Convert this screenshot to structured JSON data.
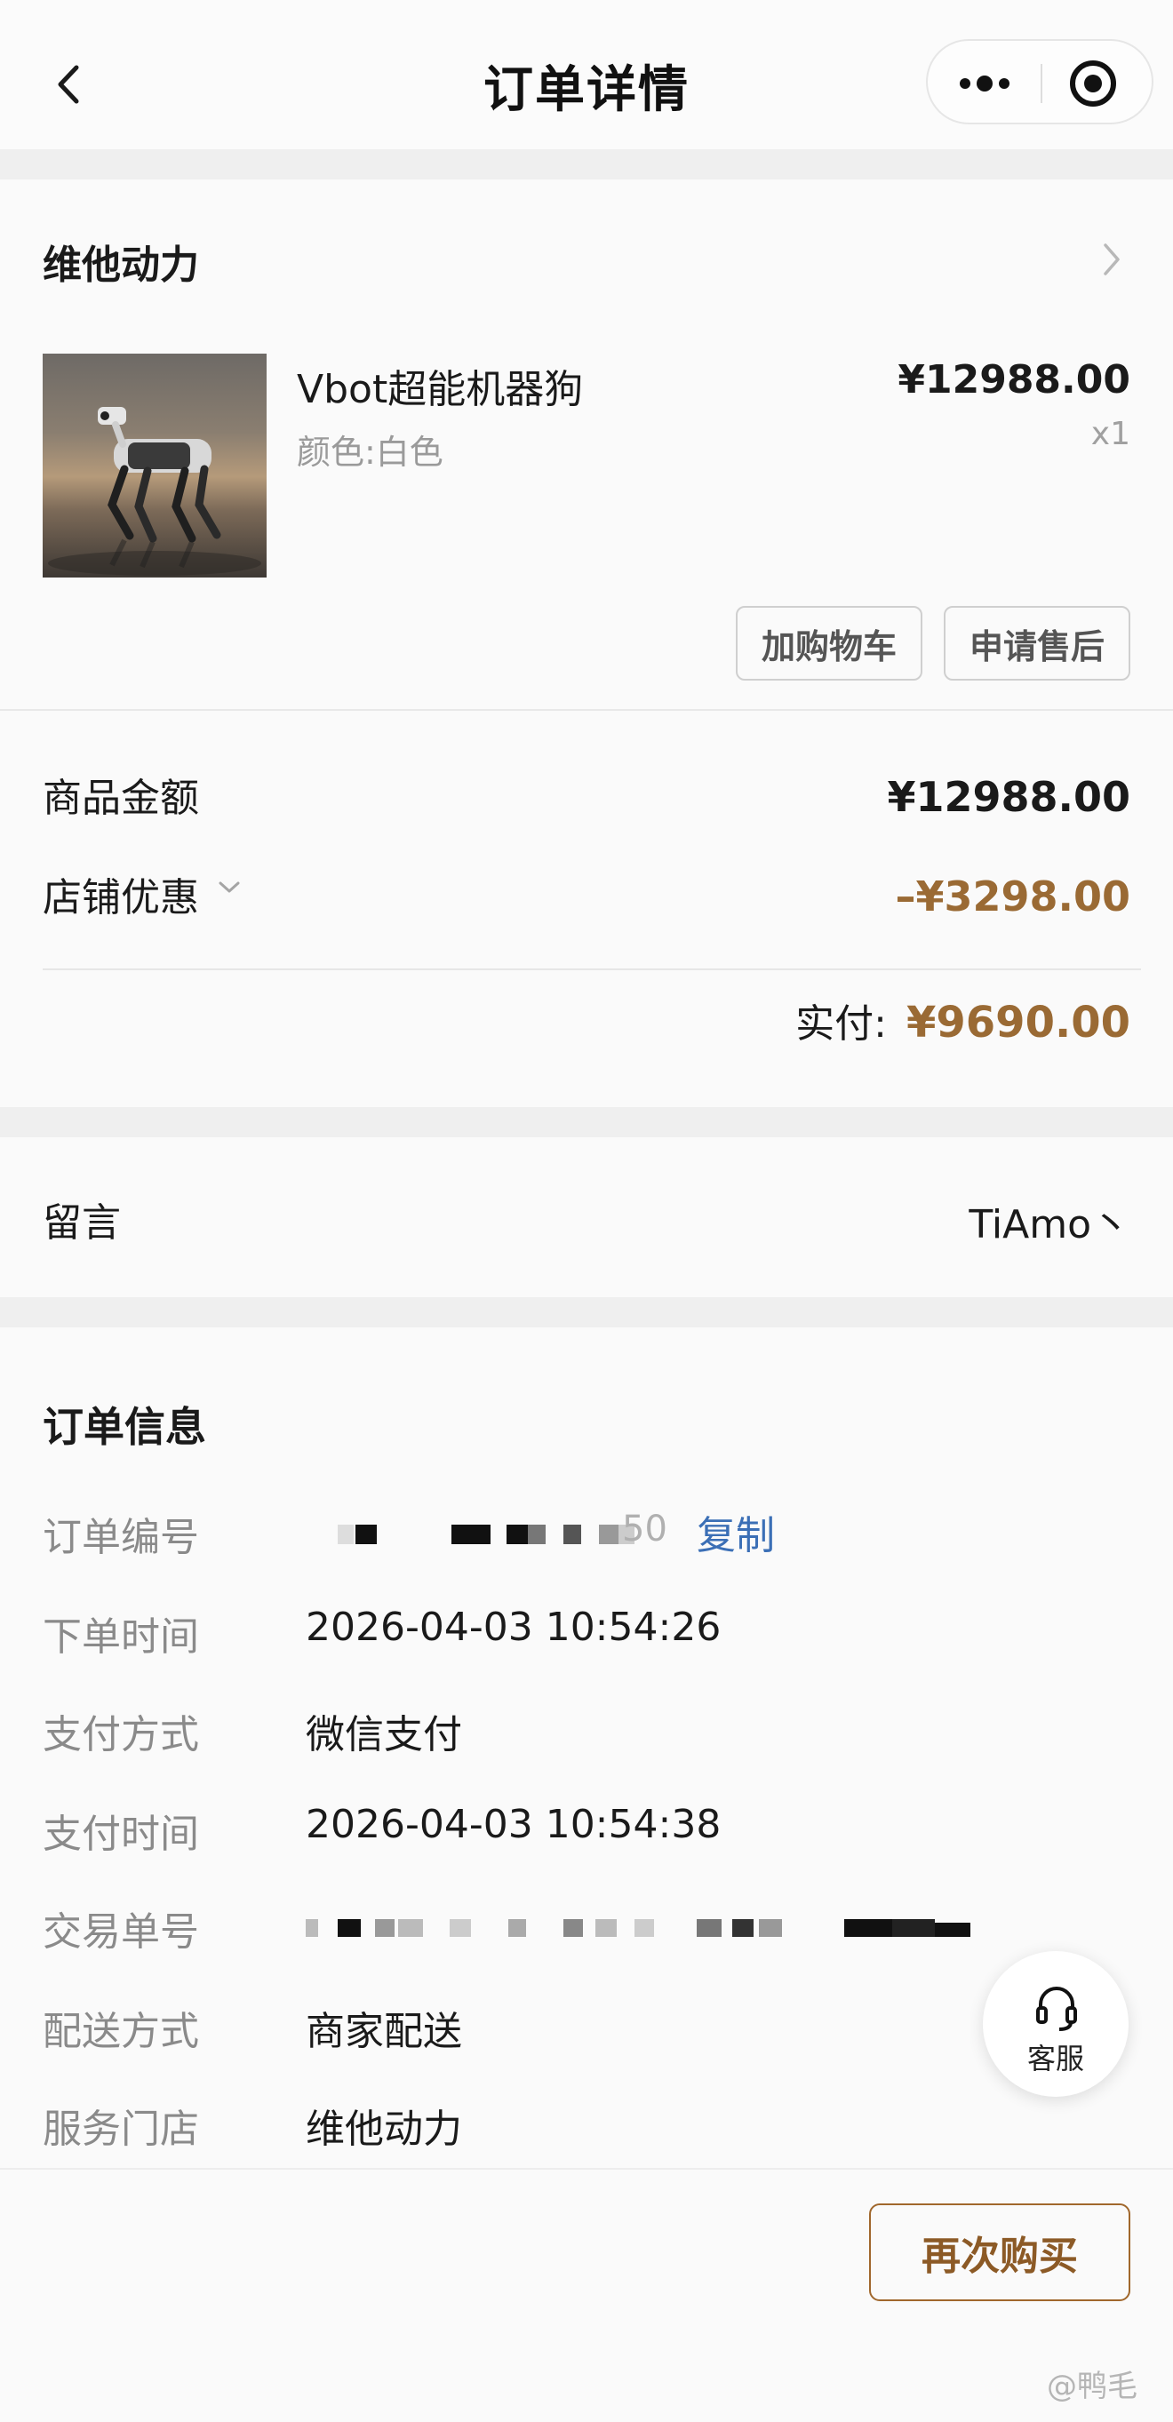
{
  "header": {
    "title": "订单详情"
  },
  "shop": {
    "name": "维他动力",
    "product": {
      "name": "Vbot超能机器狗",
      "spec": "颜色:白色",
      "price": "¥12988.00",
      "qty": "x1",
      "add_cart_label": "加购物车",
      "after_sale_label": "申请售后"
    }
  },
  "amount": {
    "goods_label": "商品金额",
    "goods_value": "¥12988.00",
    "discount_label": "店铺优惠",
    "discount_value": "–¥3298.00",
    "paid_label": "实付:",
    "paid_value": "¥9690.00"
  },
  "message": {
    "label": "留言",
    "value": "TiAmo丶"
  },
  "order_info": {
    "title": "订单信息",
    "order_no_label": "订单编号",
    "order_no_tail": "50",
    "copy_label": "复制",
    "order_time_label": "下单时间",
    "order_time_value": "2026-04-03 10:54:26",
    "pay_method_label": "支付方式",
    "pay_method_value": "微信支付",
    "pay_time_label": "支付时间",
    "pay_time_value": "2026-04-03 10:54:38",
    "trade_no_label": "交易单号",
    "delivery_label": "配送方式",
    "delivery_value": "商家配送",
    "store_label": "服务门店",
    "store_value": "维他动力"
  },
  "service": {
    "label": "客服"
  },
  "bottom": {
    "rebuy_label": "再次购买",
    "watermark": "@鸭毛"
  },
  "colors": {
    "accent": "#9a6a34",
    "link": "#3b6fb6",
    "muted": "#8a8a8a"
  },
  "icons": [
    "back-icon",
    "more-icon",
    "close-target-icon",
    "chevron-right-icon",
    "chevron-down-icon",
    "headset-icon"
  ]
}
